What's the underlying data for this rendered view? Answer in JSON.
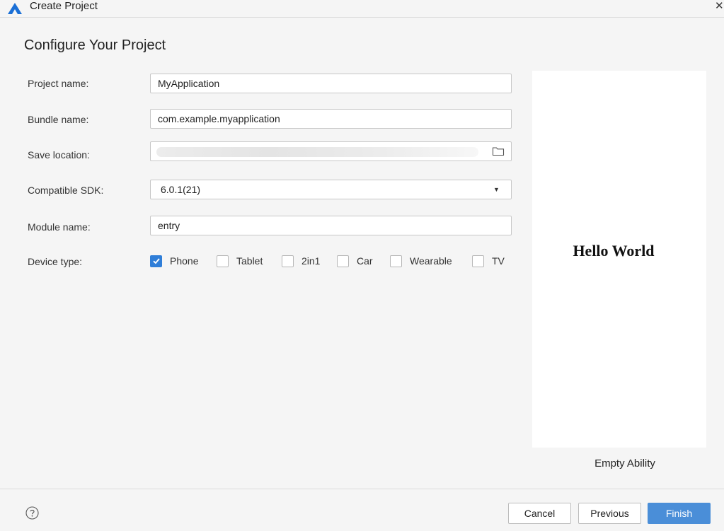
{
  "window": {
    "title": "Create Project",
    "logo_icon": "harmony-triangle-logo",
    "close_icon": "close-icon",
    "close_glyph": "✕"
  },
  "page": {
    "heading": "Configure Your Project"
  },
  "form": {
    "project_name": {
      "label": "Project name:",
      "value": "MyApplication"
    },
    "bundle_name": {
      "label": "Bundle name:",
      "value": "com.example.myapplication"
    },
    "save_location": {
      "label": "Save location:",
      "value": "",
      "browse_icon": "folder-icon"
    },
    "compatible_sdk": {
      "label": "Compatible SDK:",
      "value": "6.0.1(21)",
      "arrow_glyph": "▼"
    },
    "module_name": {
      "label": "Module name:",
      "value": "entry"
    },
    "device_type": {
      "label": "Device type:",
      "options": [
        {
          "label": "Phone",
          "checked": true
        },
        {
          "label": "Tablet",
          "checked": false
        },
        {
          "label": "2in1",
          "checked": false
        },
        {
          "label": "Car",
          "checked": false
        },
        {
          "label": "Wearable",
          "checked": false
        },
        {
          "label": "TV",
          "checked": false
        }
      ]
    }
  },
  "preview": {
    "text": "Hello World",
    "template_name": "Empty Ability"
  },
  "footer": {
    "help_icon": "help-circle-icon",
    "cancel_label": "Cancel",
    "previous_label": "Previous",
    "finish_label": "Finish"
  },
  "colors": {
    "accent": "#2f7ed8",
    "primary_button": "#4a8ed8",
    "background": "#f5f5f5",
    "logo": "#1a6fd6"
  }
}
